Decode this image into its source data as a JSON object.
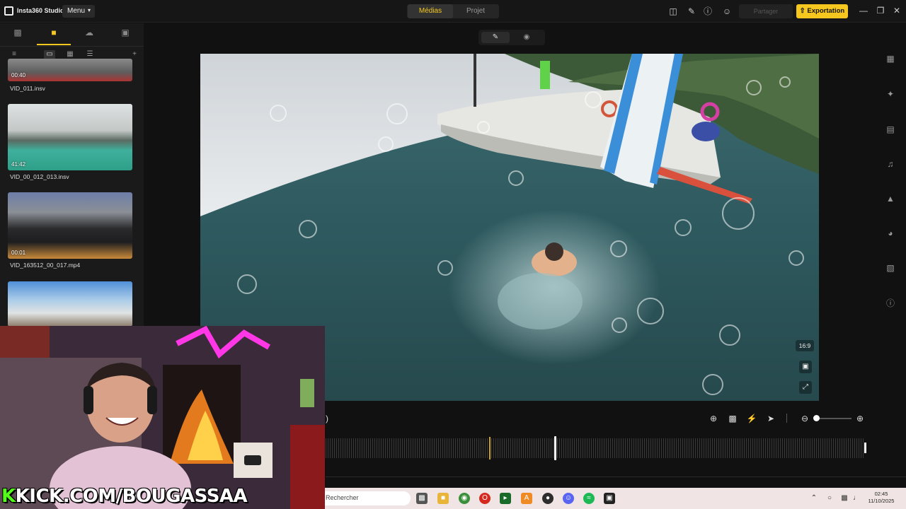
{
  "titlebar": {
    "app_name": "Insta360 Studio",
    "menu_label": "Menu",
    "tabs": [
      {
        "label": "Médias",
        "active": true
      },
      {
        "label": "Projet",
        "active": false
      }
    ],
    "share_label": "Partager",
    "export_label": "Exportation",
    "icons": [
      "panel-icon",
      "edit-badge-icon",
      "help-icon",
      "user-icon"
    ]
  },
  "sidebar": {
    "tabs": [
      "monitor-icon",
      "folder-icon",
      "cloud-icon",
      "import-icon"
    ],
    "active_tab": 1,
    "media": [
      {
        "name": "VID_011.insv",
        "duration": "00:40"
      },
      {
        "name": "VID_00_012_013.insv",
        "duration": "41:42"
      },
      {
        "name": "VID_163512_00_017.mp4",
        "duration": "00:01"
      },
      {
        "name": "",
        "duration": ""
      }
    ]
  },
  "preview": {
    "aspect_ratio": "16:9"
  },
  "taskbar": {
    "search_placeholder": "Rechercher",
    "time": "02:45",
    "date": "11/10/2025"
  },
  "webcam": {
    "url_k": "K",
    "url_rest": "KICK.COM/BOUGASSAA"
  },
  "colors": {
    "accent": "#f6c81f",
    "kick_green": "#53fc18"
  }
}
